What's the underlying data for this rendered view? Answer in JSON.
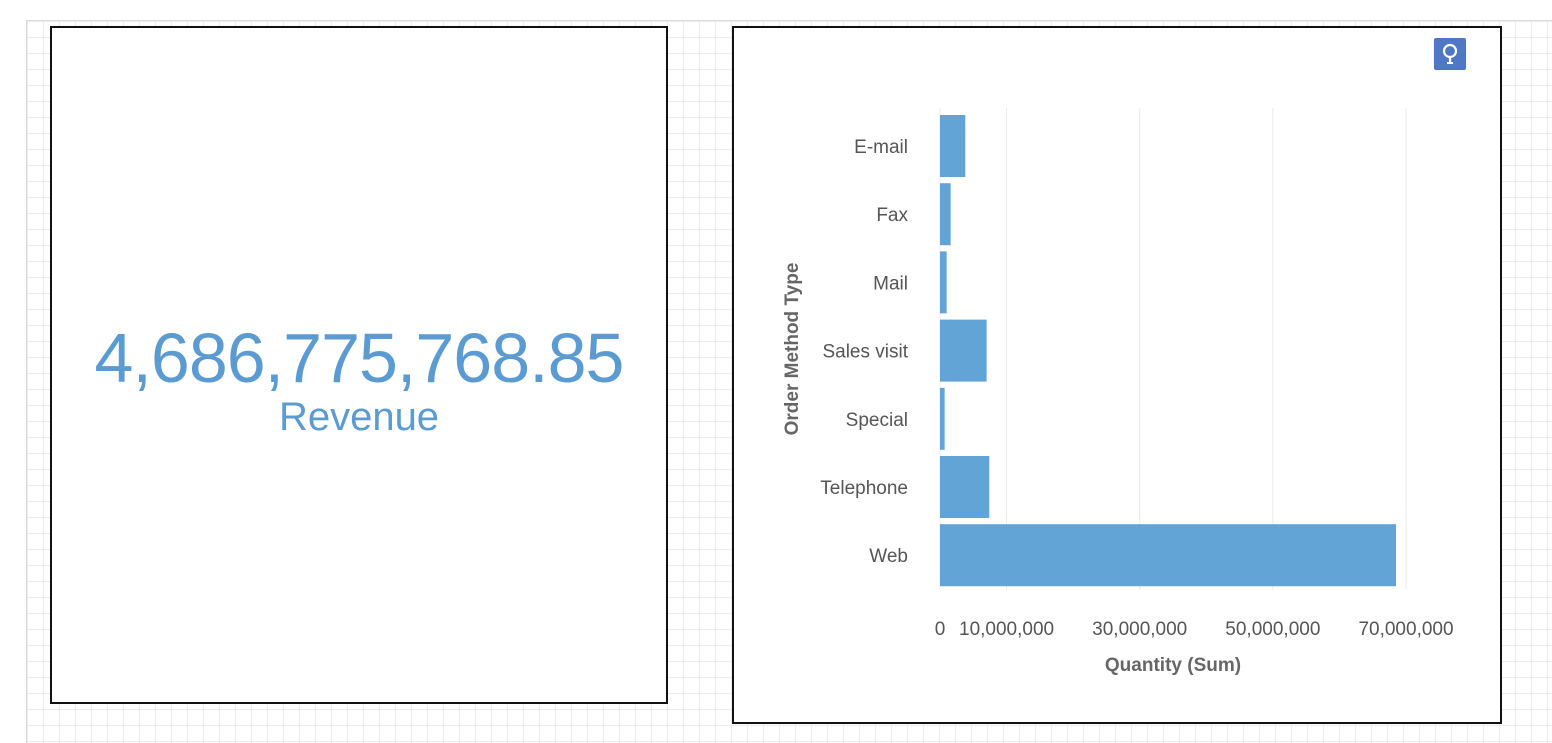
{
  "kpi": {
    "value": "4,686,775,768.85",
    "label": "Revenue"
  },
  "insight_button": {
    "icon": "lightbulb-icon"
  },
  "colors": {
    "accent": "#5b9bd1",
    "bar": "#63a4d6",
    "insight_button": "#4e78c4",
    "grid": "#ebebeb",
    "text": "#555555"
  },
  "chart_data": {
    "type": "bar",
    "orientation": "horizontal",
    "categories": [
      "E-mail",
      "Fax",
      "Mail",
      "Sales visit",
      "Special",
      "Telephone",
      "Web"
    ],
    "values": [
      3800000,
      1600000,
      1000000,
      7000000,
      700000,
      7400000,
      68500000
    ],
    "xlabel": "Quantity (Sum)",
    "ylabel": "Order Method Type",
    "xlim": [
      0,
      70000000
    ],
    "ticks": [
      {
        "value": 0,
        "label": "0"
      },
      {
        "value": 10000000,
        "label": "10,000,000"
      },
      {
        "value": 30000000,
        "label": "30,000,000"
      },
      {
        "value": 50000000,
        "label": "50,000,000"
      },
      {
        "value": 70000000,
        "label": "70,000,000"
      }
    ],
    "grid": true,
    "legend": "none"
  }
}
